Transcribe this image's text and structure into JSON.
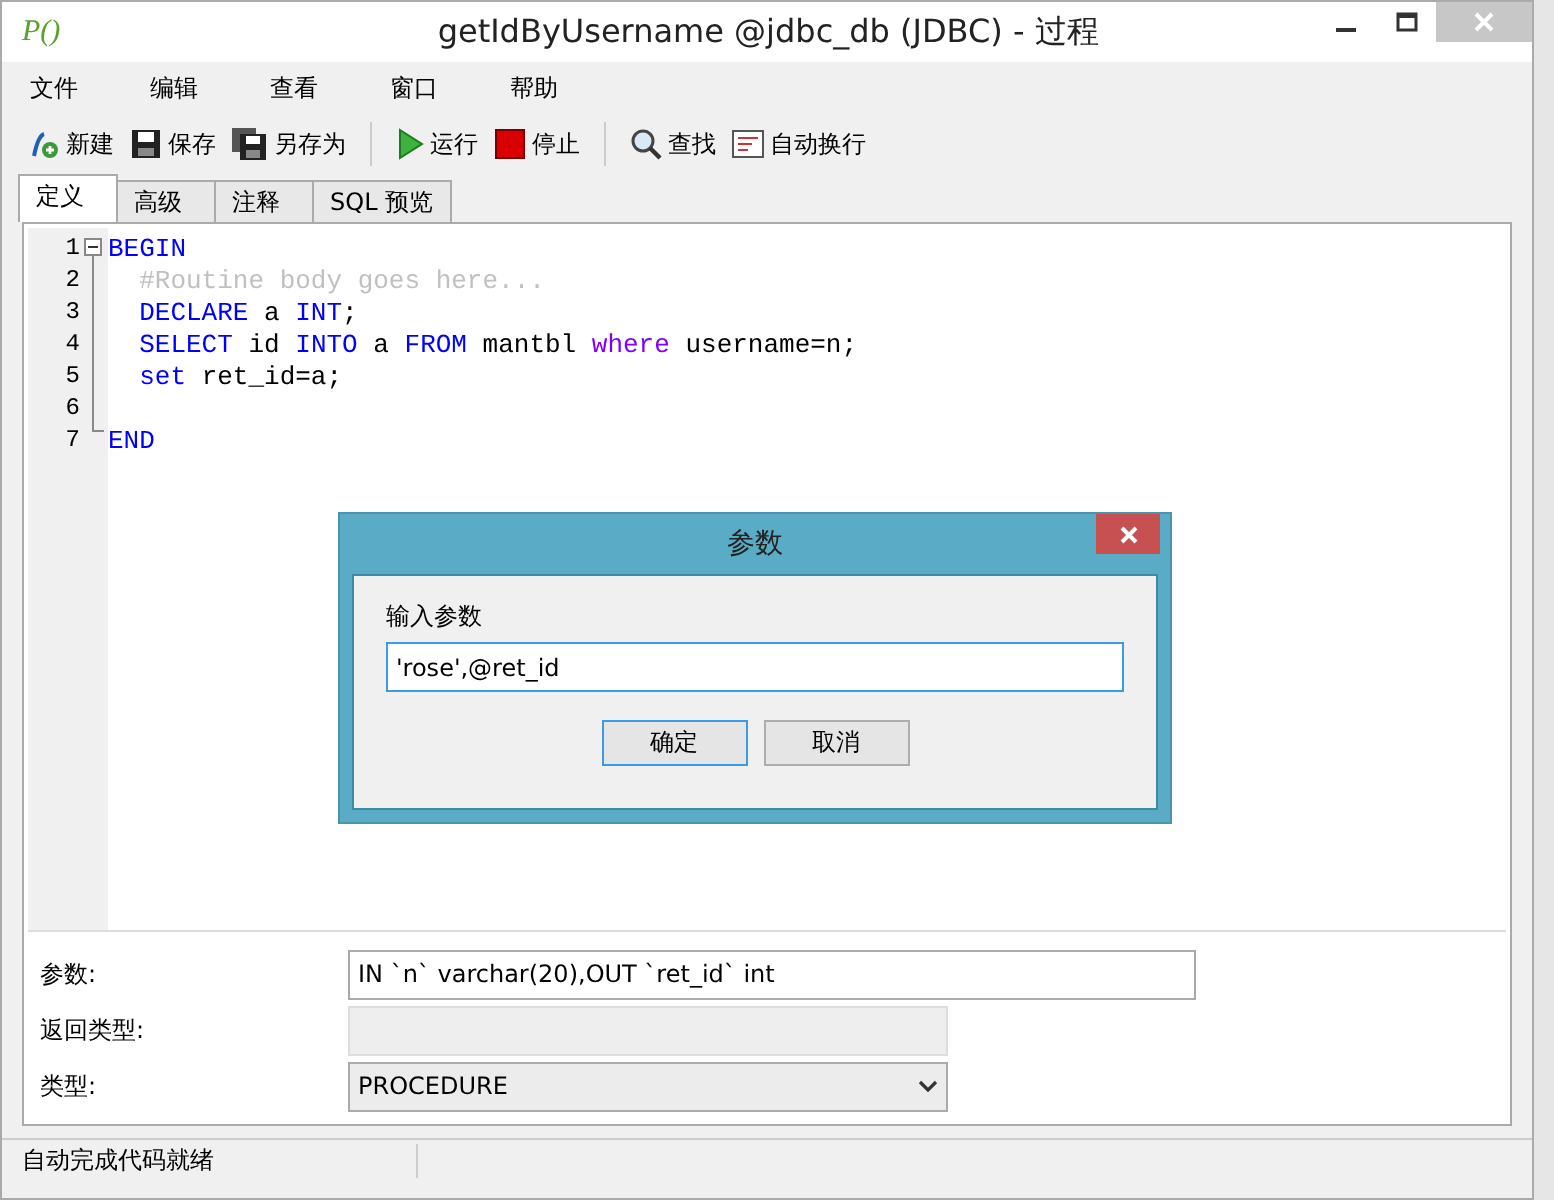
{
  "window": {
    "logo": "P()",
    "title": "getIdByUsername @jdbc_db (JDBC) - 过程"
  },
  "menu": [
    "文件",
    "编辑",
    "查看",
    "窗口",
    "帮助"
  ],
  "toolbar": [
    {
      "kind": "new",
      "label": "新建"
    },
    {
      "kind": "save",
      "label": "保存"
    },
    {
      "kind": "saveas",
      "label": "另存为"
    },
    {
      "kind": "separator"
    },
    {
      "kind": "run",
      "label": "运行"
    },
    {
      "kind": "stop",
      "label": "停止"
    },
    {
      "kind": "separator"
    },
    {
      "kind": "find",
      "label": "查找"
    },
    {
      "kind": "wrap",
      "label": "自动换行"
    }
  ],
  "tabs": [
    {
      "label": "定义",
      "selected": true
    },
    {
      "label": "高级",
      "selected": false
    },
    {
      "label": "注释",
      "selected": false
    },
    {
      "label": "SQL 预览",
      "selected": false
    }
  ],
  "code_lines": [
    {
      "number": "1",
      "tokens": [
        {
          "kind": "keyword",
          "text": "BEGIN"
        }
      ]
    },
    {
      "number": "2",
      "tokens": [
        {
          "kind": "comment",
          "text": "  #Routine body goes here..."
        }
      ]
    },
    {
      "number": "3",
      "tokens": [
        {
          "kind": "keyword",
          "text": "  DECLARE"
        },
        {
          "kind": "plain",
          "text": " a "
        },
        {
          "kind": "keyword",
          "text": "INT"
        },
        {
          "kind": "plain",
          "text": ";"
        }
      ]
    },
    {
      "number": "4",
      "tokens": [
        {
          "kind": "keyword",
          "text": "  SELECT"
        },
        {
          "kind": "plain",
          "text": " id "
        },
        {
          "kind": "keyword",
          "text": "INTO"
        },
        {
          "kind": "plain",
          "text": " a "
        },
        {
          "kind": "keyword",
          "text": "FROM"
        },
        {
          "kind": "plain",
          "text": " mantbl "
        },
        {
          "kind": "keyword2",
          "text": "where"
        },
        {
          "kind": "plain",
          "text": " username=n;"
        }
      ]
    },
    {
      "number": "5",
      "tokens": [
        {
          "kind": "keyword",
          "text": "  set"
        },
        {
          "kind": "plain",
          "text": " ret_id=a;"
        }
      ]
    },
    {
      "number": "6"
    },
    {
      "number": "7",
      "tokens": [
        {
          "kind": "keyword",
          "text": "END"
        }
      ]
    }
  ],
  "form": [
    {
      "kind": "input",
      "label": "参数:",
      "value": "IN `n` varchar(20),OUT `ret_id` int"
    },
    {
      "kind": "disabled",
      "label": "返回类型:"
    },
    {
      "kind": "select",
      "label": "类型:",
      "value": "PROCEDURE"
    }
  ],
  "status_bar": "自动完成代码就绪",
  "dialog": {
    "title": "参数",
    "label": "输入参数",
    "value": "'rose',@ret_id",
    "buttons": [
      {
        "label": "确定",
        "selected": true
      },
      {
        "label": "取消",
        "selected": false
      }
    ]
  }
}
